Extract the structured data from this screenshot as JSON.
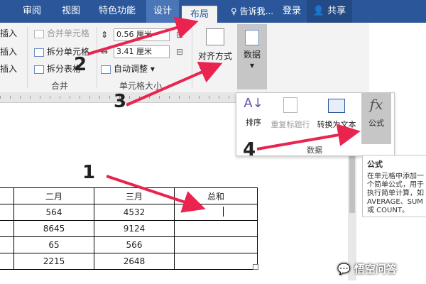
{
  "tabs": [
    {
      "label": "审阅"
    },
    {
      "label": "视图"
    },
    {
      "label": "特色功能"
    },
    {
      "label": "设计"
    },
    {
      "label": "布局"
    }
  ],
  "tell_me": "告诉我...",
  "login": "登录",
  "share": "共享",
  "ribbon": {
    "insert_left_1": "插入",
    "insert_left_2": "插入",
    "insert_left_3": "插入",
    "merge_cells": "合并单元格",
    "split_cells": "拆分单元格",
    "split_table": "拆分表格",
    "merge_group": "合并",
    "height_value": "0.56 厘米",
    "width_value": "3.41 厘米",
    "autofit": "自动调整",
    "cell_size_group": "单元格大小",
    "alignment": "对齐方式",
    "data": "数据"
  },
  "data_panel": {
    "sort": "排序",
    "repeat_header": "重复标题行",
    "convert_text": "转换为文本",
    "formula": "公式",
    "group": "数据"
  },
  "tooltip": {
    "title": "公式",
    "body": "在单元格中添加一个简单公式，用于执行简单计算，如 AVERAGE、SUM 或 COUNT。"
  },
  "table": {
    "header": [
      "",
      "二月",
      "三月",
      "总和"
    ],
    "rows": [
      [
        "",
        "564",
        "4532",
        ""
      ],
      [
        "",
        "8645",
        "9124",
        ""
      ],
      [
        "",
        "65",
        "566",
        ""
      ],
      [
        "",
        "2215",
        "2648",
        ""
      ]
    ]
  },
  "annotations": {
    "n1": "1",
    "n2": "2",
    "n3": "3",
    "n4": "4"
  },
  "watermark": "悟空问答",
  "colors": {
    "brand": "#2b579a",
    "arrow": "#e8244f",
    "ribbon_bg": "#f3f3f3"
  }
}
